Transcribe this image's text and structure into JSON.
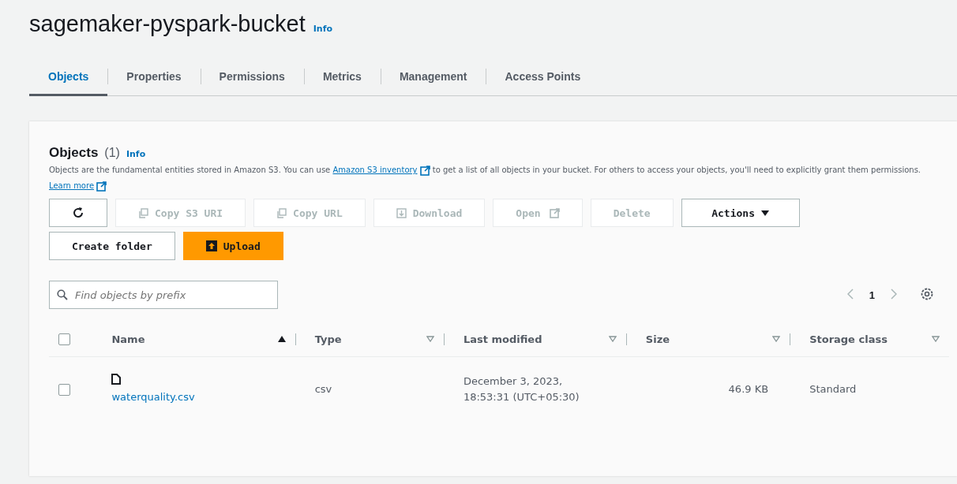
{
  "bucket": {
    "title": "sagemaker-pyspark-bucket",
    "info": "Info"
  },
  "tabs": [
    {
      "label": "Objects",
      "selected": true
    },
    {
      "label": "Properties",
      "selected": false
    },
    {
      "label": "Permissions",
      "selected": false
    },
    {
      "label": "Metrics",
      "selected": false
    },
    {
      "label": "Management",
      "selected": false
    },
    {
      "label": "Access Points",
      "selected": false
    }
  ],
  "objects_panel": {
    "title": "Objects",
    "count": "(1)",
    "info": "Info",
    "description": [
      {
        "kind": "text",
        "text": "Objects are the fundamental entities stored in Amazon S3. You can use "
      },
      {
        "kind": "link",
        "text": "Amazon S3 inventory"
      },
      {
        "kind": "text",
        "text": " to get a list of all objects in your bucket. For others to access your objects, you'll need to explicitly grant them permissions. "
      },
      {
        "kind": "link",
        "text": "Learn more"
      }
    ],
    "toolbar": [
      {
        "kind": "refresh",
        "disabled": false
      },
      {
        "kind": "copy",
        "label": "Copy S3 URI",
        "disabled": true
      },
      {
        "kind": "copy",
        "label": "Copy URL",
        "disabled": true
      },
      {
        "kind": "download",
        "label": "Download",
        "disabled": true
      },
      {
        "kind": "external",
        "label": "Open",
        "disabled": true
      },
      {
        "kind": "plain",
        "label": "Delete",
        "disabled": true
      },
      {
        "kind": "dropdown",
        "label": "Actions",
        "disabled": false
      }
    ],
    "actions": [
      {
        "kind": "plain",
        "label": "Create folder"
      },
      {
        "kind": "primary",
        "label": "Upload"
      }
    ],
    "search": {
      "placeholder": "Find objects by prefix"
    },
    "pagination": {
      "page": "1"
    },
    "table": {
      "select_all_checked": false,
      "columns": [
        {
          "label": "Name",
          "sorted": true
        },
        {
          "label": "Type",
          "sorted": false
        },
        {
          "label": "Last modified",
          "sorted": false
        },
        {
          "label": "Size",
          "sorted": false
        },
        {
          "label": "Storage class",
          "sorted": false
        }
      ],
      "rows": [
        {
          "checked": false,
          "name": "waterquality.csv",
          "type": "csv",
          "last_modified": "December 3, 2023, 18:53:31 (UTC+05:30)",
          "size": "46.9 KB",
          "storage_class": "Standard"
        }
      ]
    }
  }
}
